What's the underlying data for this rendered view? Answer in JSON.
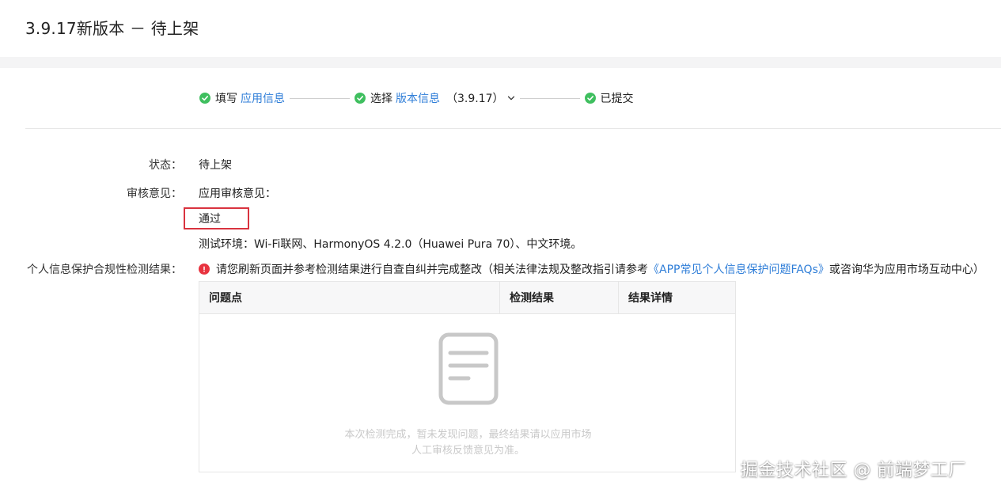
{
  "page": {
    "title": "3.9.17新版本 － 待上架"
  },
  "steps": [
    {
      "prefix": "填写",
      "link": "应用信息",
      "extra": ""
    },
    {
      "prefix": "选择",
      "link": "版本信息",
      "extra": "（3.9.17）"
    },
    {
      "prefix": "已提交",
      "link": "",
      "extra": ""
    }
  ],
  "colors": {
    "success": "#3fbf5f",
    "link": "#2f7ed8",
    "error": "#e8333f",
    "highlight_box": "#d9333f"
  },
  "form": {
    "status_label": "状态：",
    "status_value": "待上架",
    "review_label": "审核意见：",
    "review_heading": "应用审核意见：",
    "review_result": "通过",
    "test_env": "测试环境：Wi-Fi联网、HarmonyOS 4.2.0（Huawei Pura 70）、中文环境。",
    "privacy_label": "个人信息保护合规性检测结果：",
    "privacy_notice_prefix": "请您刷新页面并参考检测结果进行自查自纠并完成整改（相关法律法规及整改指引请参考",
    "privacy_notice_link": "《APP常见个人信息保护问题FAQs》",
    "privacy_notice_suffix": "或咨询华为应用市场互动中心）"
  },
  "table": {
    "columns": [
      "问题点",
      "检测结果",
      "结果详情"
    ],
    "empty_icon": "document-icon",
    "empty_line1": "本次检测完成，暂未发现问题，最终结果请以应用市场",
    "empty_line2": "人工审核反馈意见为准。"
  },
  "watermark": "掘金技术社区 @ 前端梦工厂"
}
